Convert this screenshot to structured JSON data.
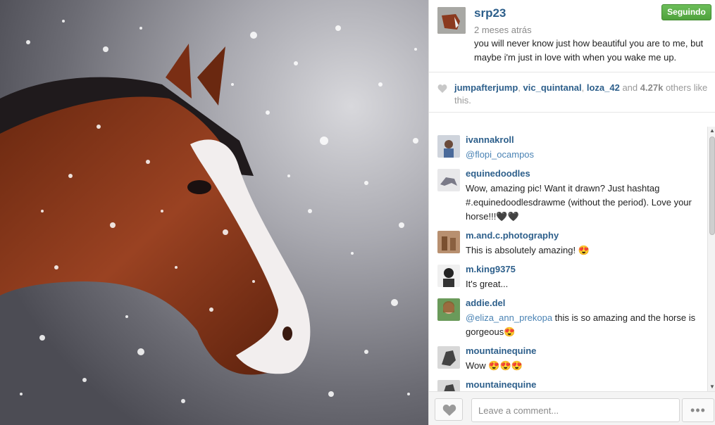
{
  "post": {
    "username": "srp23",
    "time": "2 meses atrás",
    "caption": "you will never know just how beautiful you are to me, but maybe i'm just in love with when you wake me up.",
    "follow_label": "Seguindo"
  },
  "likes": {
    "likers": [
      "jumpafterjump",
      "vic_quintanal",
      "loza_42"
    ],
    "and_word": "and",
    "count": "4.27k",
    "suffix": "others like this."
  },
  "comments": [
    {
      "user": "ivannakroll",
      "mention": "@flopi_ocampos",
      "text": ""
    },
    {
      "user": "equinedoodles",
      "mention": "",
      "text": "Wow, amazing pic! Want it drawn? Just hashtag #.equinedoodlesdrawme (without the period). Love your horse!!!🖤🖤"
    },
    {
      "user": "m.and.c.photography",
      "mention": "",
      "text": "This is absolutely amazing! 😍"
    },
    {
      "user": "m.king9375",
      "mention": "",
      "text": "It's great..."
    },
    {
      "user": "addie.del",
      "mention": "@eliza_ann_prekopa",
      "text": " this is so amazing and the horse is gorgeous😍"
    },
    {
      "user": "mountainequine",
      "mention": "",
      "text": "Wow 😍😍😍"
    },
    {
      "user": "mountainequine",
      "mention": "",
      "text": ""
    }
  ],
  "footer": {
    "comment_placeholder": "Leave a comment...",
    "more_label": "•••"
  },
  "colors": {
    "accent_link": "#2d5f8b",
    "follow_green": "#5cb348",
    "horse_brown": "#8b3a1e"
  }
}
